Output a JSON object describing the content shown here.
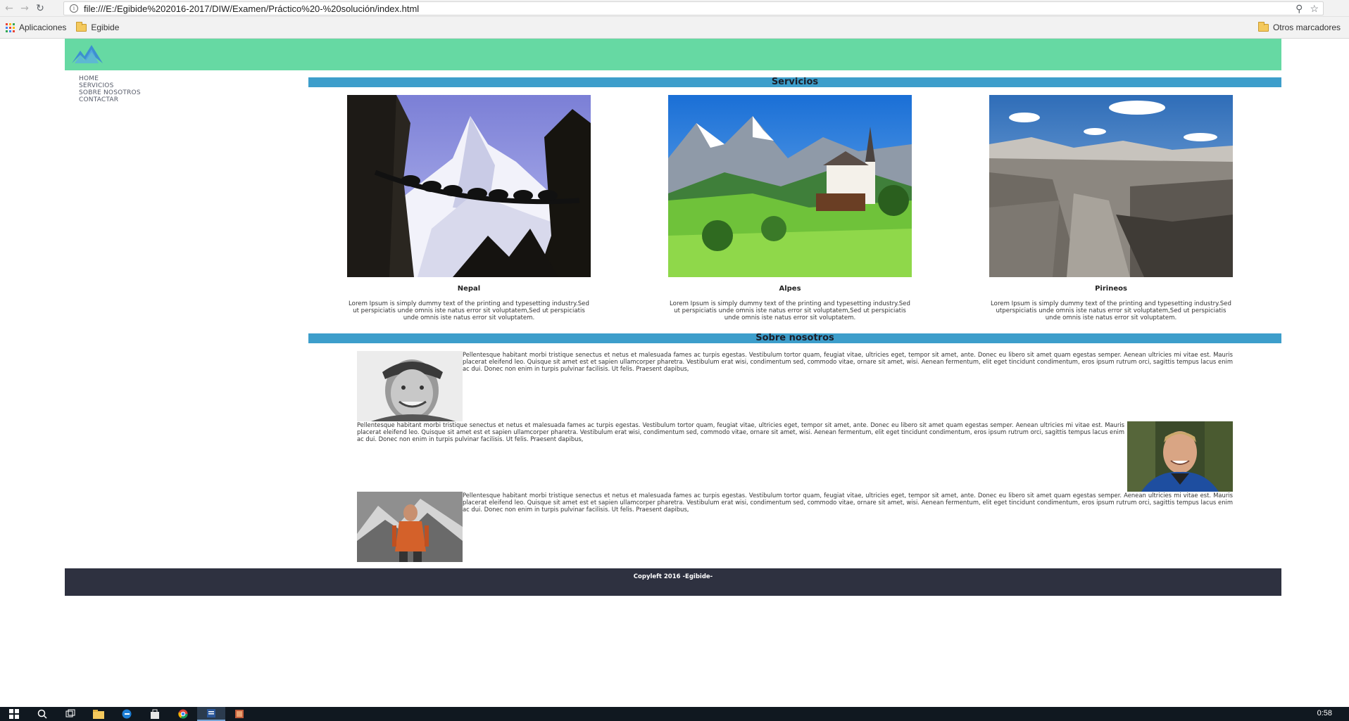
{
  "browser": {
    "url": "file:///E:/Egibide%202016-2017/DIW/Examen/Práctico%20-%20solución/index.html",
    "bookmarks": [
      {
        "label": "Aplicaciones",
        "icon": "apps-grid-icon"
      },
      {
        "label": "Egibide",
        "icon": "folder-icon"
      }
    ],
    "other_bookmarks": "Otros marcadores"
  },
  "site": {
    "colors": {
      "header": "#66d9a3",
      "section_bar": "#3d9ecb",
      "footer": "#2e3140"
    },
    "nav": [
      "HOME",
      "SERVICIOS",
      "SOBRE NOSOTROS",
      "CONTACTAR"
    ],
    "services": {
      "heading": "Servicios",
      "cards": [
        {
          "title": "Nepal",
          "description": "Lorem Ipsum is simply dummy text of the printing and typesetting industry.Sed ut perspiciatis unde omnis iste natus error sit voluptatem,Sed ut perspiciatis unde omnis iste natus error sit voluptatem."
        },
        {
          "title": "Alpes",
          "description": "Lorem Ipsum is simply dummy text of the printing and typesetting industry.Sed ut perspiciatis unde omnis iste natus error sit voluptatem,Sed ut perspiciatis unde omnis iste natus error sit voluptatem."
        },
        {
          "title": "Pirineos",
          "description": "Lorem Ipsum is simply dummy text of the printing and typesetting industry.Sed utperspiciatis unde omnis iste natus error sit voluptatem,Sed ut perspiciatis unde omnis iste natus error sit voluptatem."
        }
      ]
    },
    "about": {
      "heading": "Sobre nosotros",
      "paragraphs": [
        "Pellentesque habitant morbi tristique senectus et netus et malesuada fames ac turpis egestas. Vestibulum tortor quam, feugiat vitae, ultricies eget, tempor sit amet, ante. Donec eu libero sit amet quam egestas semper. Aenean ultricies mi vitae est. Mauris placerat eleifend leo. Quisque sit amet est et sapien ullamcorper pharetra. Vestibulum erat wisi, condimentum sed, commodo vitae, ornare sit amet, wisi. Aenean fermentum, elit eget tincidunt condimentum, eros ipsum rutrum orci, sagittis tempus lacus enim ac dui. Donec non enim in turpis pulvinar facilisis. Ut felis. Praesent dapibus,",
        "Pellentesque habitant morbi tristique senectus et netus et malesuada fames ac turpis egestas. Vestibulum tortor quam, feugiat vitae, ultricies eget, tempor sit amet, ante. Donec eu libero sit amet quam egestas semper. Aenean ultricies mi vitae est. Mauris placerat eleifend leo. Quisque sit amet est et sapien ullamcorper pharetra. Vestibulum erat wisi, condimentum sed, commodo vitae, ornare sit amet, wisi. Aenean fermentum, elit eget tincidunt condimentum, eros ipsum rutrum orci, sagittis tempus lacus enim ac dui. Donec non enim in turpis pulvinar facilisis. Ut felis. Praesent dapibus,",
        "Pellentesque habitant morbi tristique senectus et netus et malesuada fames ac turpis egestas. Vestibulum tortor quam, feugiat vitae, ultricies eget, tempor sit amet, ante. Donec eu libero sit amet quam egestas semper. Aenean ultricies mi vitae est. Mauris placerat eleifend leo. Quisque sit amet est et sapien ullamcorper pharetra. Vestibulum erat wisi, condimentum sed, commodo vitae, ornare sit amet, wisi. Aenean fermentum, elit eget tincidunt condimentum, eros ipsum rutrum orci, sagittis tempus lacus enim ac dui. Donec non enim in turpis pulvinar facilisis. Ut felis. Praesent dapibus,"
      ]
    },
    "footer": "Copyleft 2016 -Egibide-"
  },
  "taskbar": {
    "clock": "0:58"
  }
}
